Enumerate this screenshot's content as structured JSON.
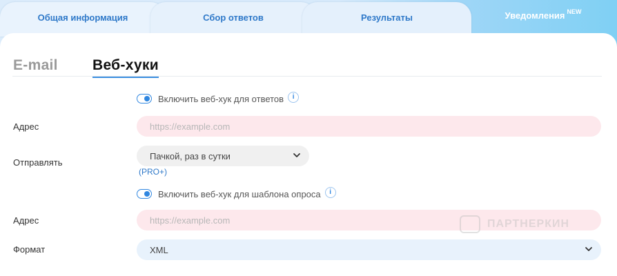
{
  "tabs": [
    {
      "label": "Общая информация"
    },
    {
      "label": "Сбор ответов"
    },
    {
      "label": "Результаты"
    },
    {
      "label": "Уведомления",
      "badge": "NEW"
    }
  ],
  "subtabs": {
    "email": "E-mail",
    "webhooks": "Веб-хуки"
  },
  "answers_hook": {
    "toggle_label": "Включить веб-хук для ответов",
    "info": "i",
    "address_label": "Адрес",
    "address_placeholder": "https://example.com",
    "send_label": "Отправлять",
    "send_value": "Пачкой, раз в сутки",
    "pro_badge": "(PRO+)"
  },
  "template_hook": {
    "toggle_label": "Включить веб-хук для шаблона опроса",
    "info": "i",
    "address_label": "Адрес",
    "address_placeholder": "https://example.com",
    "format_label": "Формат",
    "format_value": "XML"
  },
  "watermark": "ПАРТНЕРКИН",
  "colors": {
    "accent": "#2f86e0",
    "input_bg": "#fde8ec",
    "select_bg": "#f0f0f0",
    "format_bg": "#e8f2fc"
  }
}
